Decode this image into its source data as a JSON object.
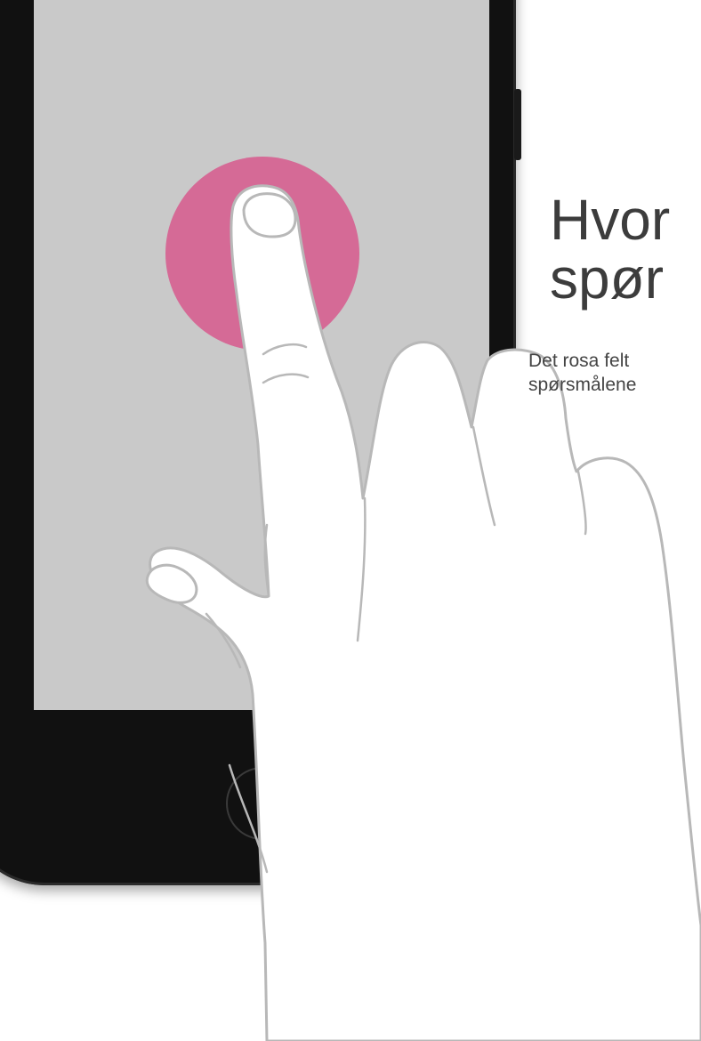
{
  "heading": {
    "line1": "Hvor",
    "line2": "spør"
  },
  "body": {
    "line1": "Det rosa felt",
    "line2": "spørsmålene"
  },
  "colors": {
    "screen": "#c9c9c9",
    "pink_spot": "#d56a96",
    "phone_body": "#111111",
    "text": "#3c3c3c"
  },
  "icons": {
    "hand": "pointing-hand-icon",
    "home": "home-button-icon"
  }
}
